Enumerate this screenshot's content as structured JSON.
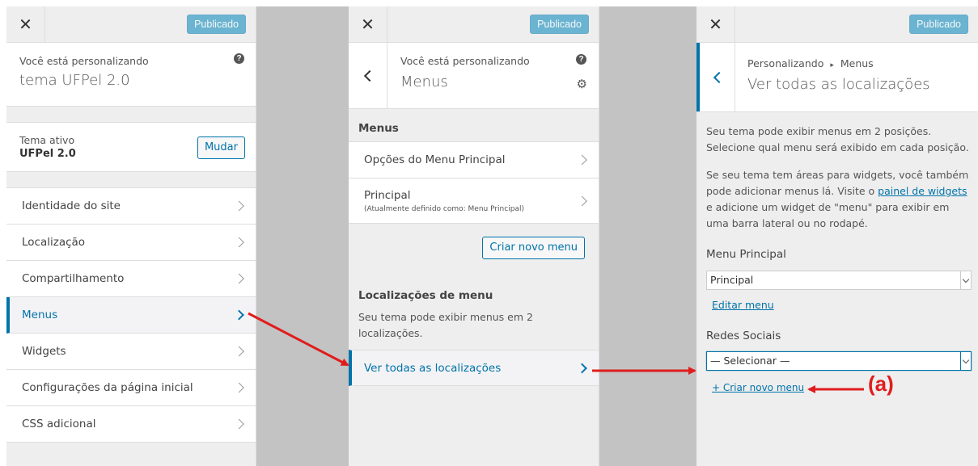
{
  "publish_label": "Publicado",
  "panel1": {
    "customizing_label": "Você está personalizando",
    "theme_title": "tema UFPel 2.0",
    "active_theme_label": "Tema ativo",
    "active_theme_name": "UFPel 2.0",
    "change_button": "Mudar",
    "items": [
      {
        "label": "Identidade do site"
      },
      {
        "label": "Localização"
      },
      {
        "label": "Compartilhamento"
      },
      {
        "label": "Menus"
      },
      {
        "label": "Widgets"
      },
      {
        "label": "Configurações da página inicial"
      },
      {
        "label": "CSS adicional"
      }
    ]
  },
  "panel2": {
    "customizing_label": "Você está personalizando",
    "title": "Menus",
    "section_heading": "Menus",
    "menu_items": [
      {
        "label": "Opções do Menu Principal",
        "sub": ""
      },
      {
        "label": "Principal",
        "sub": "(Atualmente definido como: Menu Principal)"
      }
    ],
    "create_menu_button": "Criar novo menu",
    "locations_heading": "Localizações de menu",
    "locations_desc": "Seu tema pode exibir menus em 2 localizações.",
    "view_all_locations": "Ver todas as localizações"
  },
  "panel3": {
    "breadcrumb_root": "Personalizando",
    "breadcrumb_sep": "▸",
    "breadcrumb_current": "Menus",
    "title": "Ver todas as localizações",
    "desc1": "Seu tema pode exibir menus em 2 posições. Selecione qual menu será exibido em cada posição.",
    "desc2_before": "Se seu tema tem áreas para widgets, você também pode adicionar menus lá. Visite o ",
    "desc2_link": "painel de widgets",
    "desc2_after": " e adicione um widget de \"menu\" para exibir em uma barra lateral ou no rodapé.",
    "location1_label": "Menu Principal",
    "location1_value": "Principal",
    "edit_menu_link": "Editar menu",
    "location2_label": "Redes Sociais",
    "location2_value": "— Selecionar —",
    "create_menu_link": "+ Criar novo menu"
  },
  "annotation_label": "(a)",
  "colors": {
    "accent": "#0073aa",
    "arrow": "#e01d1d",
    "panel_bg": "#eeeeee",
    "gap": "#c3c3c3"
  }
}
